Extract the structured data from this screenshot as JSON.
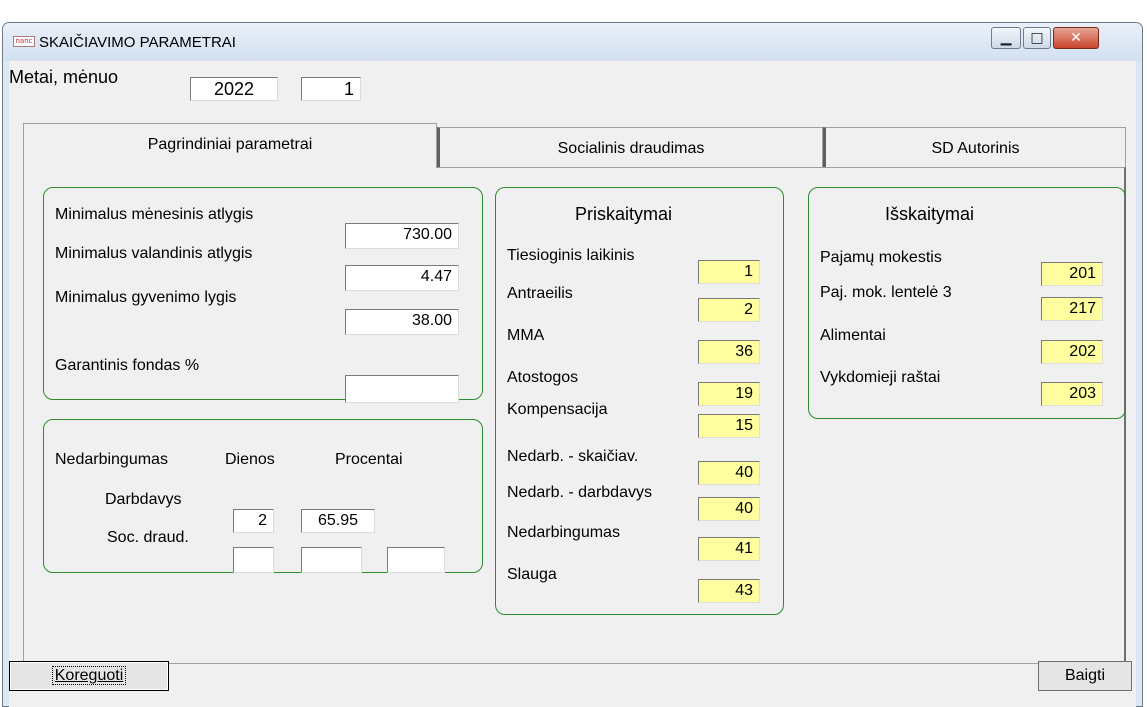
{
  "window": {
    "title": "SKAIČIAVIMO  PARAMETRAI",
    "icon_text": "nanc",
    "buttons": {
      "minimize": "▁",
      "maximize": "□",
      "close": "✕"
    }
  },
  "period": {
    "label": "Metai, mėnuo",
    "year": "2022",
    "month": "1"
  },
  "tabs": [
    {
      "label": "Pagrindiniai parametrai",
      "active": true
    },
    {
      "label": "Socialinis draudimas",
      "active": false
    },
    {
      "label": "SD Autorinis",
      "active": false
    }
  ],
  "basic": {
    "rows": [
      {
        "label": "Minimalus mėnesinis atlygis",
        "value": "730.00"
      },
      {
        "label": "Minimalus valandinis atlygis",
        "value": "4.47"
      },
      {
        "label": "Minimalus gyvenimo lygis",
        "value": "38.00"
      },
      {
        "label": "Garantinis fondas %",
        "value": ""
      }
    ]
  },
  "disability": {
    "header": {
      "col1": "Nedarbingumas",
      "col2": "Dienos",
      "col3": "Procentai"
    },
    "rows": [
      {
        "label": "Darbdavys",
        "days": "2",
        "percent": "65.95",
        "extra": null
      },
      {
        "label": "Soc. draud.",
        "days": "",
        "percent": "",
        "extra": ""
      }
    ]
  },
  "accruals": {
    "title": "Priskaitymai",
    "items": [
      {
        "label": "Tiesioginis laikinis",
        "code": "1"
      },
      {
        "label": "Antraeilis",
        "code": "2"
      },
      {
        "label": "MMA",
        "code": "36"
      },
      {
        "label": "Atostogos",
        "code": "19"
      },
      {
        "label": "Kompensacija",
        "code": "15"
      },
      {
        "label": "Nedarb. - skaičiav.",
        "code": "40"
      },
      {
        "label": "Nedarb. - darbdavys",
        "code": "40"
      },
      {
        "label": "Nedarbingumas",
        "code": "41"
      },
      {
        "label": "Slauga",
        "code": "43"
      }
    ]
  },
  "deductions": {
    "title": "Išskaitymai",
    "items": [
      {
        "label": "Pajamų mokestis",
        "code": "201"
      },
      {
        "label": "Paj. mok. lentelė 3",
        "code": "217"
      },
      {
        "label": "Alimentai",
        "code": "202"
      },
      {
        "label": "Vykdomieji raštai",
        "code": "203"
      }
    ]
  },
  "footer": {
    "edit_button": "Koreguoti",
    "finish_button": "Baigti"
  },
  "colors": {
    "group_border": "#2e8b2e",
    "code_field": "#ffffa0",
    "window_bg": "#f0f0f0"
  }
}
